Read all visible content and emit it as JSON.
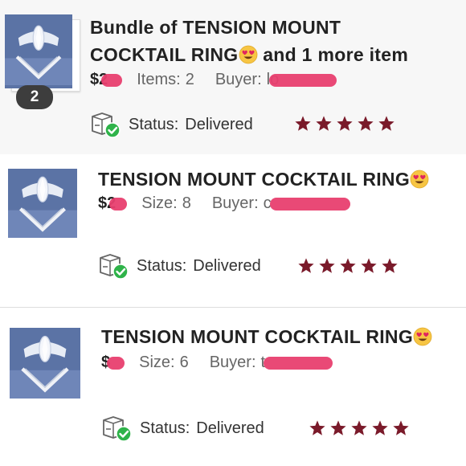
{
  "orders": [
    {
      "title_line1": "Bundle of TENSION MOUNT",
      "title_line2": "COCKTAIL RING",
      "title_suffix": "and 1 more item",
      "price": "$2",
      "detail_label": "Items:",
      "detail_value": "2",
      "buyer_label": "Buyer:",
      "buyer_visible": "lo",
      "badge": "2",
      "status_label": "Status:",
      "status_value": "Delivered",
      "rating": 5
    },
    {
      "title_line1": "TENSION MOUNT COCKTAIL RING",
      "price": "$2",
      "detail_label": "Size:",
      "detail_value": "8",
      "buyer_label": "Buyer:",
      "buyer_visible": "c",
      "status_label": "Status:",
      "status_value": "Delivered",
      "rating": 5
    },
    {
      "title_line1": "TENSION MOUNT COCKTAIL RING",
      "price": "$",
      "detail_label": "Size:",
      "detail_value": "6",
      "buyer_label": "Buyer:",
      "buyer_visible": "t",
      "status_label": "Status:",
      "status_value": "Delivered",
      "rating": 5
    }
  ],
  "colors": {
    "star": "#7a1a2a",
    "redaction": "#e83f6f",
    "status_check": "#2fb34a",
    "thumb_bg": "#5b73a5"
  },
  "icons": [
    "ring-thumbnail",
    "heart-eyes-emoji",
    "package-delivered-icon",
    "star-icon"
  ]
}
